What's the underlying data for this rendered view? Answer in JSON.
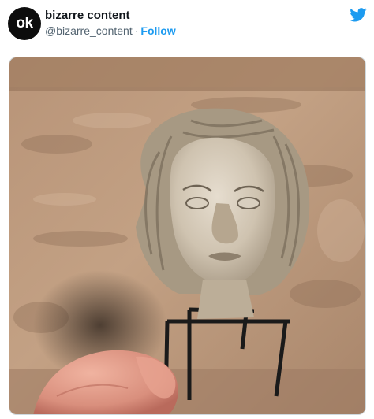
{
  "tweet": {
    "avatar_text": "ok",
    "display_name": "bizarre content",
    "handle": "@bizarre_content",
    "separator": "·",
    "follow_label": "Follow"
  },
  "icons": {
    "brand": "twitter-bird-icon"
  },
  "colors": {
    "accent": "#1d9bf0",
    "name_text": "#0f1419",
    "handle_text": "#536471",
    "avatar_bg": "#0d0d0d"
  },
  "media": {
    "image": "photo-of-marble-statue-head-on-metal-stand-with-thumb-in-foreground"
  }
}
